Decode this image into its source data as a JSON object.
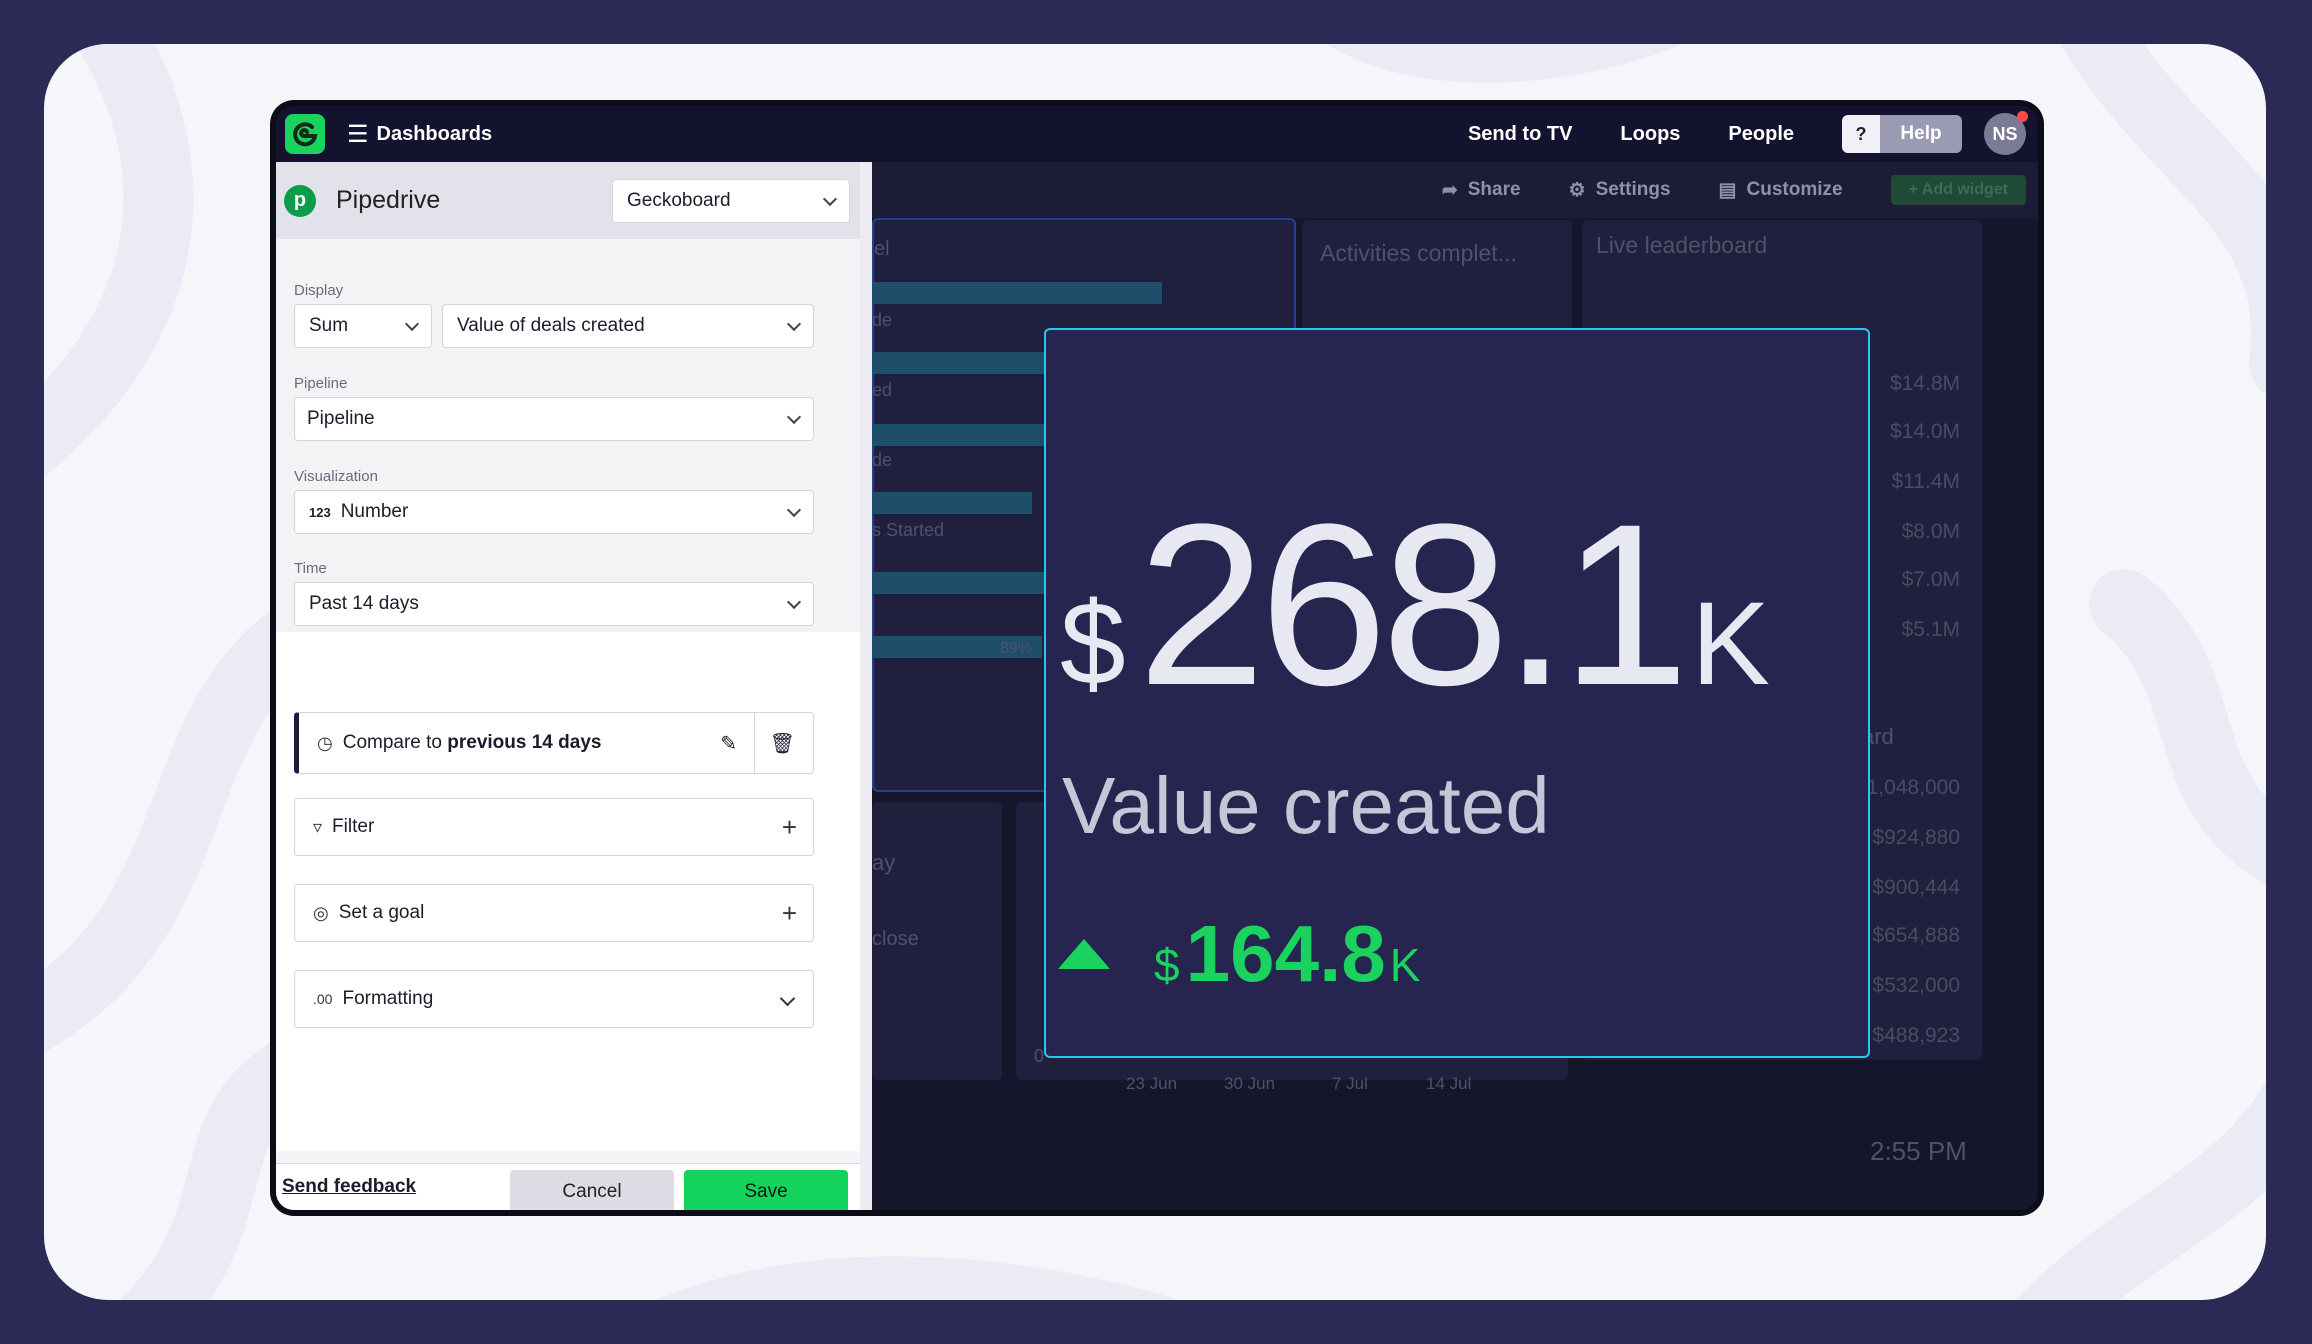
{
  "topbar": {
    "menu_label": "Dashboards",
    "nav": [
      "Send to TV",
      "Loops",
      "People"
    ],
    "help_q": "?",
    "help": "Help",
    "avatar": "NS"
  },
  "dashboard": {
    "toolbar": {
      "share": "Share",
      "settings": "Settings",
      "customize": "Customize",
      "add_widget": "Add widget"
    },
    "widget_titles": {
      "activities": "Activities complet...",
      "leaderboard": "Live leaderboard"
    },
    "funnel_fragments": [
      "el",
      "de",
      "ed",
      "de",
      "s Started",
      "89%"
    ],
    "leaderboard_values": [
      "$14.8M",
      "$14.0M",
      "$11.4M",
      "$8.0M",
      "$7.0M",
      "$5.1M"
    ],
    "leaderboard2_title": "ard",
    "leaderboard2_values": [
      "1,048,000",
      "$924,880",
      "$900,444",
      "$654,888",
      "$532,000",
      "$488,923"
    ],
    "bottom_fragments": {
      "w1": "ay",
      "w2": "close",
      "zero": "0"
    },
    "x_ticks": [
      "23 Jun",
      "30 Jun",
      "7 Jul",
      "14 Jul"
    ],
    "clock": "2:55 PM"
  },
  "widget": {
    "currency": "$",
    "value": "268.1",
    "suffix": "K",
    "label": "Value created",
    "compare_currency": "$",
    "compare_value": "164.8",
    "compare_suffix": "K",
    "trend": "up",
    "accent": "#19d35e",
    "border": "#25c8f0"
  },
  "panel": {
    "source": "Pipedrive",
    "account": "Geckoboard",
    "display_label": "Display",
    "display_agg": "Sum",
    "display_metric": "Value of deals created",
    "pipeline_label": "Pipeline",
    "pipeline_value": "Pipeline",
    "visualization_label": "Visualization",
    "visualization_icon": "123",
    "visualization_value": "Number",
    "time_label": "Time",
    "time_value": "Past 14 days",
    "compare_prefix": "Compare to ",
    "compare_bold": "previous 14 days",
    "filter": "Filter",
    "goal": "Set a goal",
    "formatting_icon": ".00",
    "formatting": "Formatting",
    "send_feedback": "Send feedback",
    "cancel": "Cancel",
    "save": "Save"
  }
}
